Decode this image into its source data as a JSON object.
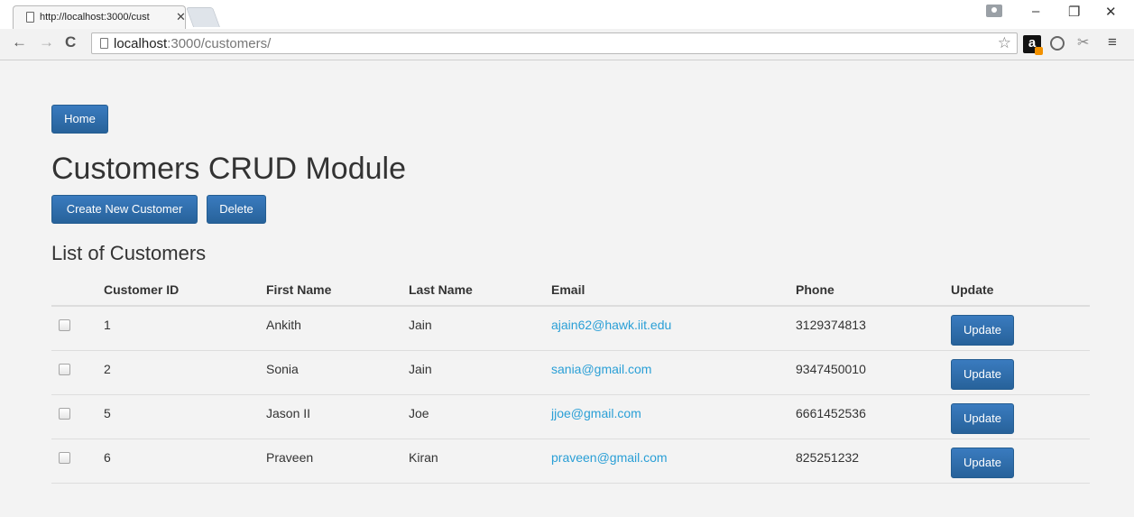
{
  "browser": {
    "tab_title": "http://localhost:3000/cust",
    "url_host": "localhost",
    "url_rest": ":3000/customers/"
  },
  "page": {
    "home_label": "Home",
    "title": "Customers CRUD Module",
    "create_label": "Create New Customer",
    "delete_label": "Delete",
    "list_title": "List of Customers"
  },
  "table": {
    "headers": [
      "Customer ID",
      "First Name",
      "Last Name",
      "Email",
      "Phone",
      "Update"
    ],
    "update_label": "Update",
    "rows": [
      {
        "id": "1",
        "first": "Ankith",
        "last": "Jain",
        "email": "ajain62@hawk.iit.edu",
        "phone": "3129374813"
      },
      {
        "id": "2",
        "first": "Sonia",
        "last": "Jain",
        "email": "sania@gmail.com",
        "phone": "9347450010"
      },
      {
        "id": "5",
        "first": "Jason II",
        "last": "Joe",
        "email": "jjoe@gmail.com",
        "phone": "6661452536"
      },
      {
        "id": "6",
        "first": "Praveen",
        "last": "Kiran",
        "email": "praveen@gmail.com",
        "phone": "825251232"
      }
    ]
  },
  "colors": {
    "button_blue": "#2e6da4",
    "link_blue": "#2a9fd6",
    "page_bg": "#f3f3f3"
  }
}
